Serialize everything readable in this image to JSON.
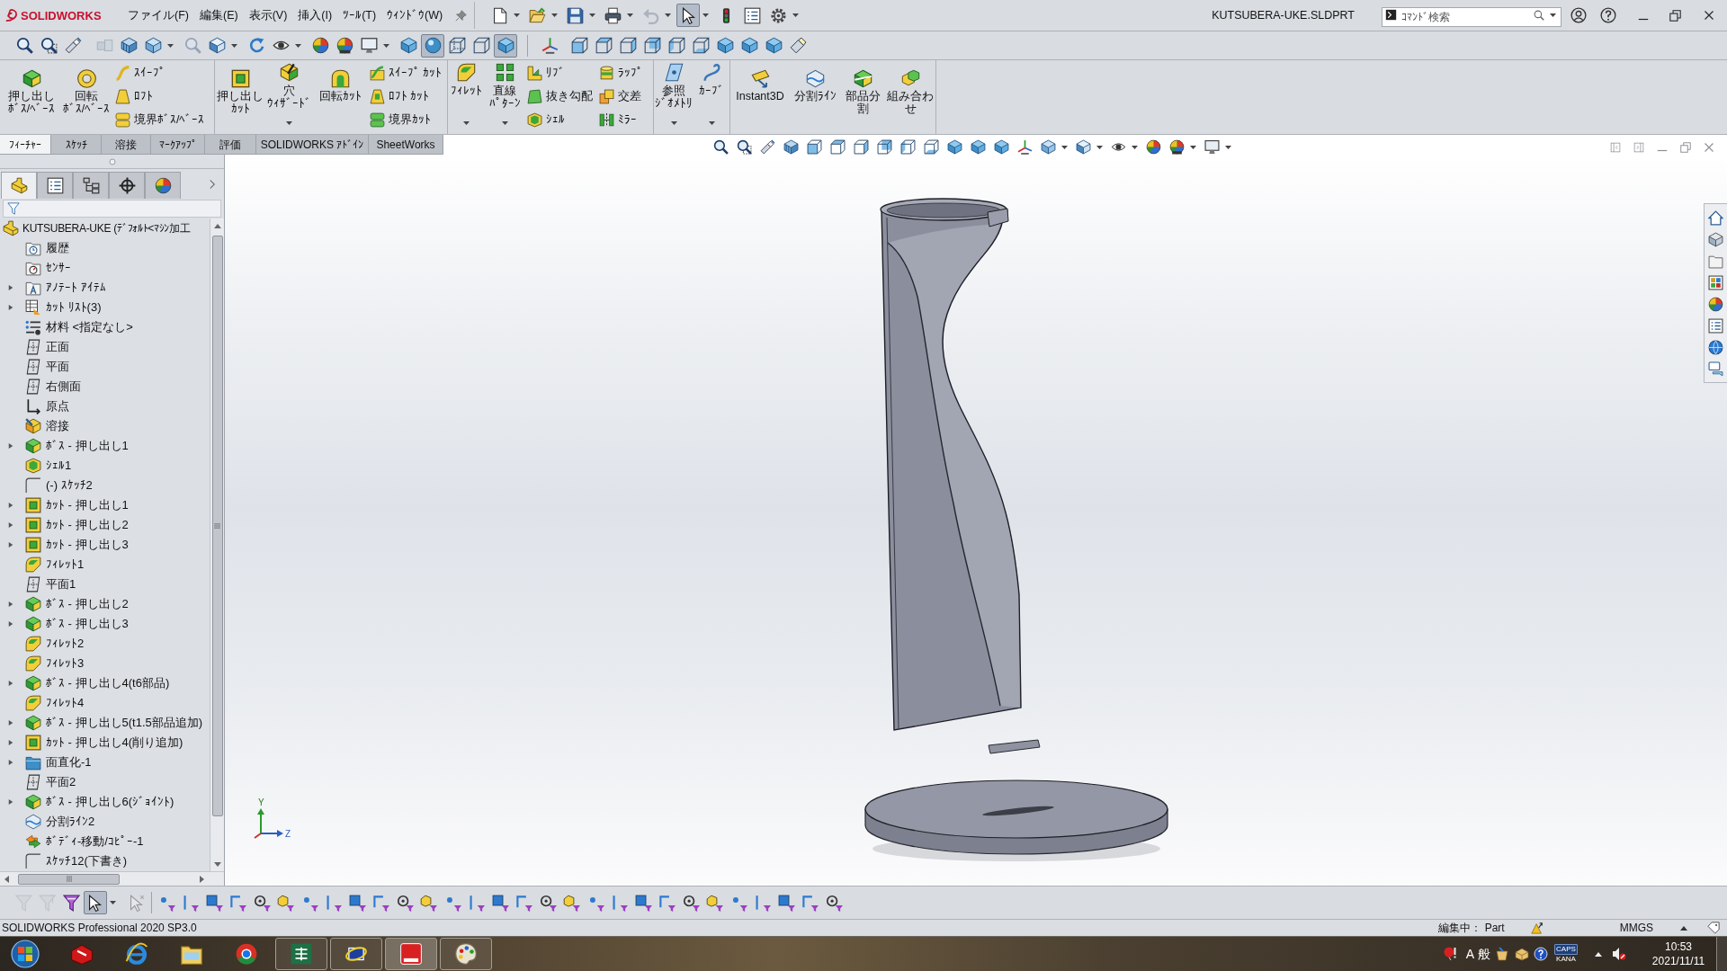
{
  "title_bar": {
    "logo": "SOLIDWORKS",
    "menu": [
      "ファイル(F)",
      "編集(E)",
      "表示(V)",
      "挿入(I)",
      "ﾂｰﾙ(T)",
      "ｳｨﾝﾄﾞｳ(W)"
    ],
    "quick_access": [
      {
        "on": false,
        "disabled": false
      },
      {
        "on": false,
        "disabled": false
      },
      {
        "on": false,
        "disabled": false
      },
      {
        "on": false,
        "disabled": false
      },
      {
        "on": false,
        "disabled": true
      },
      {
        "on": true,
        "disabled": false
      },
      {
        "on": false,
        "disabled": false
      },
      {
        "on": false,
        "disabled": false
      },
      {
        "on": false,
        "disabled": false
      }
    ],
    "document_title": "KUTSUBERA-UKE.SLDPRT",
    "search": {
      "placeholder": "ｺﾏﾝﾄﾞ検索"
    }
  },
  "view_toolbar": [
    {
      "on": false,
      "disabled": false
    },
    {
      "on": false,
      "disabled": false
    },
    {
      "on": false,
      "disabled": false
    },
    {
      "on": false,
      "disabled": true
    },
    {
      "on": false,
      "disabled": false
    },
    {
      "on": false,
      "disabled": false
    },
    {
      "on": false,
      "disabled": true
    },
    {
      "on": false,
      "disabled": false
    },
    {
      "on": false,
      "disabled": false
    },
    {
      "on": false,
      "disabled": false
    },
    {
      "on": false,
      "disabled": false
    },
    {
      "on": false,
      "disabled": false
    },
    {
      "on": false,
      "disabled": false
    },
    {
      "on": false,
      "disabled": false
    },
    {
      "on": true,
      "disabled": false
    },
    {
      "on": false,
      "disabled": false
    },
    {
      "on": false,
      "disabled": false
    },
    {
      "on": true,
      "disabled": false
    },
    {
      "on": false,
      "disabled": false
    },
    {
      "on": false,
      "disabled": false
    },
    {
      "on": false,
      "disabled": false
    },
    {
      "on": false,
      "disabled": false
    },
    {
      "on": false,
      "disabled": false
    },
    {
      "on": false,
      "disabled": false
    },
    {
      "on": false,
      "disabled": false
    },
    {
      "on": false,
      "disabled": false
    },
    {
      "on": false,
      "disabled": false
    },
    {
      "on": false,
      "disabled": false
    },
    {
      "on": false,
      "disabled": false
    }
  ],
  "ribbon": [
    {
      "items": [
        {
          "kind": "large",
          "lines": [
            "押し出し",
            "ﾎﾞｽ/ﾍﾞｰｽ"
          ],
          "dropdown": false
        },
        {
          "kind": "large",
          "lines": [
            "回転",
            "ﾎﾞｽ/ﾍﾞｰｽ"
          ],
          "dropdown": false
        },
        {
          "kind": "stack",
          "labels": [
            "ｽｲｰﾌﾟ",
            "ﾛﾌﾄ",
            "境界ﾎﾞｽ/ﾍﾞｰｽ"
          ]
        }
      ]
    },
    {
      "items": [
        {
          "kind": "large",
          "lines": [
            "押し出し",
            "ｶｯﾄ"
          ],
          "dropdown": false
        },
        {
          "kind": "large",
          "lines": [
            "穴",
            "ｳｨｻﾞｰﾄﾞ"
          ],
          "dropdown": true
        },
        {
          "kind": "large",
          "lines": [
            "回転ｶｯﾄ"
          ],
          "dropdown": false
        },
        {
          "kind": "stack",
          "labels": [
            "ｽｲｰﾌﾟ ｶｯﾄ",
            "ﾛﾌﾄ ｶｯﾄ",
            "境界ｶｯﾄ"
          ]
        }
      ]
    },
    {
      "items": [
        {
          "kind": "large",
          "lines": [
            "ﾌｨﾚｯﾄ"
          ],
          "dropdown": true
        },
        {
          "kind": "large",
          "lines": [
            "直線",
            "ﾊﾟﾀｰﾝ"
          ],
          "dropdown": true
        },
        {
          "kind": "stack",
          "labels": [
            "ﾘﾌﾞ",
            "抜き勾配",
            "ｼｪﾙ"
          ]
        },
        {
          "kind": "stack",
          "labels": [
            "ﾗｯﾌﾟ",
            "交差",
            "ﾐﾗｰ"
          ]
        }
      ]
    },
    {
      "items": [
        {
          "kind": "large",
          "lines": [
            "参照",
            "ｼﾞｵﾒﾄﾘ"
          ],
          "dropdown": true
        },
        {
          "kind": "large",
          "lines": [
            "ｶｰﾌﾞ"
          ],
          "dropdown": true
        }
      ]
    },
    {
      "items": [
        {
          "kind": "large",
          "lines": [
            "Instant3D"
          ],
          "dropdown": false
        },
        {
          "kind": "large",
          "lines": [
            "分割ﾗｲﾝ"
          ],
          "dropdown": false
        },
        {
          "kind": "large",
          "lines": [
            "部品分",
            "割"
          ],
          "dropdown": false
        },
        {
          "kind": "large",
          "lines": [
            "組み合わ",
            "せ"
          ],
          "dropdown": false
        }
      ]
    }
  ],
  "tabs": [
    {
      "label": "ﾌｨｰﾁｬｰ",
      "selected": true
    },
    {
      "label": "ｽｹｯﾁ",
      "selected": false
    },
    {
      "label": "溶接",
      "selected": false
    },
    {
      "label": "ﾏｰｸｱｯﾌﾟ",
      "selected": false
    },
    {
      "label": "評価",
      "selected": false
    },
    {
      "label": "SOLIDWORKS ｱﾄﾞｲﾝ",
      "selected": false
    },
    {
      "label": "SheetWorks",
      "selected": false
    }
  ],
  "feature_manager": {
    "panel_tabs": [
      {
        "selected": true
      },
      {
        "selected": false
      },
      {
        "selected": false
      },
      {
        "selected": false
      },
      {
        "selected": false
      }
    ],
    "tree": {
      "label": "KUTSUBERA-UKE (ﾃﾞﾌｫﾙﾄ<ﾏｼﾝ加工",
      "children": [
        {
          "label": "履歴",
          "expandable": false
        },
        {
          "label": "ｾﾝｻｰ",
          "expandable": false
        },
        {
          "label": "ｱﾉﾃｰﾄ ｱｲﾃﾑ",
          "expandable": true
        },
        {
          "label": "ｶｯﾄ ﾘｽﾄ(3)",
          "expandable": true
        },
        {
          "label": "材料 <指定なし>",
          "expandable": false
        },
        {
          "label": "正面",
          "expandable": false
        },
        {
          "label": "平面",
          "expandable": false
        },
        {
          "label": "右側面",
          "expandable": false
        },
        {
          "label": "原点",
          "expandable": false
        },
        {
          "label": "溶接",
          "expandable": false
        },
        {
          "label": "ﾎﾞｽ - 押し出し1",
          "expandable": true
        },
        {
          "label": "ｼｪﾙ1",
          "expandable": false
        },
        {
          "label": "(-) ｽｹｯﾁ2",
          "expandable": false
        },
        {
          "label": "ｶｯﾄ - 押し出し1",
          "expandable": true
        },
        {
          "label": "ｶｯﾄ - 押し出し2",
          "expandable": true
        },
        {
          "label": "ｶｯﾄ - 押し出し3",
          "expandable": true
        },
        {
          "label": "ﾌｨﾚｯﾄ1",
          "expandable": false
        },
        {
          "label": "平面1",
          "expandable": false
        },
        {
          "label": "ﾎﾞｽ - 押し出し2",
          "expandable": true
        },
        {
          "label": "ﾎﾞｽ - 押し出し3",
          "expandable": true
        },
        {
          "label": "ﾌｨﾚｯﾄ2",
          "expandable": false
        },
        {
          "label": "ﾌｨﾚｯﾄ3",
          "expandable": false
        },
        {
          "label": "ﾎﾞｽ - 押し出し4(t6部品)",
          "expandable": true
        },
        {
          "label": "ﾌｨﾚｯﾄ4",
          "expandable": false
        },
        {
          "label": "ﾎﾞｽ - 押し出し5(t1.5部品追加)",
          "expandable": true
        },
        {
          "label": "ｶｯﾄ - 押し出し4(削り追加)",
          "expandable": true
        },
        {
          "label": "面直化-1",
          "expandable": true
        },
        {
          "label": "平面2",
          "expandable": false
        },
        {
          "label": "ﾎﾞｽ - 押し出し6(ｼﾞｮｲﾝﾄ)",
          "expandable": true
        },
        {
          "label": "分割ﾗｲﾝ2",
          "expandable": false
        },
        {
          "label": "ﾎﾞﾃﾞｨ-移動/ｺﾋﾟｰ-1",
          "expandable": false
        },
        {
          "label": "ｽｹｯﾁ12(下書き)",
          "expandable": false
        }
      ]
    }
  },
  "viewport": {
    "triad": {
      "y_label": "Y",
      "z_label": "Z"
    }
  },
  "selection_toolbar": [
    {
      "on": false,
      "disabled": true
    },
    {
      "on": false,
      "disabled": true
    },
    {
      "on": false,
      "disabled": false
    },
    {
      "on": true,
      "disabled": false
    },
    {
      "on": false,
      "disabled": true
    },
    {
      "on": false,
      "disabled": false
    },
    {
      "on": false,
      "disabled": false
    },
    {
      "on": false,
      "disabled": false
    },
    {
      "on": false,
      "disabled": false
    },
    {
      "on": false,
      "disabled": false
    },
    {
      "on": false,
      "disabled": false
    },
    {
      "on": false,
      "disabled": false
    },
    {
      "on": false,
      "disabled": false
    },
    {
      "on": false,
      "disabled": false
    },
    {
      "on": false,
      "disabled": false
    },
    {
      "on": false,
      "disabled": false
    },
    {
      "on": false,
      "disabled": false
    },
    {
      "on": false,
      "disabled": false
    },
    {
      "on": false,
      "disabled": false
    },
    {
      "on": false,
      "disabled": false
    },
    {
      "on": false,
      "disabled": false
    },
    {
      "on": false,
      "disabled": false
    },
    {
      "on": false,
      "disabled": false
    },
    {
      "on": false,
      "disabled": false
    },
    {
      "on": false,
      "disabled": false
    },
    {
      "on": false,
      "disabled": false
    },
    {
      "on": false,
      "disabled": false
    },
    {
      "on": false,
      "disabled": false
    },
    {
      "on": false,
      "disabled": false
    },
    {
      "on": false,
      "disabled": false
    },
    {
      "on": false,
      "disabled": false
    },
    {
      "on": false,
      "disabled": false
    },
    {
      "on": false,
      "disabled": false
    },
    {
      "on": false,
      "disabled": false
    }
  ],
  "status_bar": {
    "product": "SOLIDWORKS Professional 2020 SP3.0",
    "mode": "編集中： Part",
    "units": "MMGS"
  },
  "taskbar": {
    "apps": [
      {
        "running": false,
        "selected": false
      },
      {
        "running": false,
        "selected": false
      },
      {
        "running": false,
        "selected": false
      },
      {
        "running": false,
        "selected": false
      },
      {
        "running": true,
        "selected": false
      },
      {
        "running": true,
        "selected": false
      },
      {
        "running": true,
        "selected": true
      },
      {
        "running": true,
        "selected": false
      }
    ],
    "tray": {
      "ime_mode": "A",
      "ime_char": "般",
      "caps": "CAPS",
      "kana": "KANA",
      "time": "10:53",
      "date": "2021/11/11"
    }
  }
}
